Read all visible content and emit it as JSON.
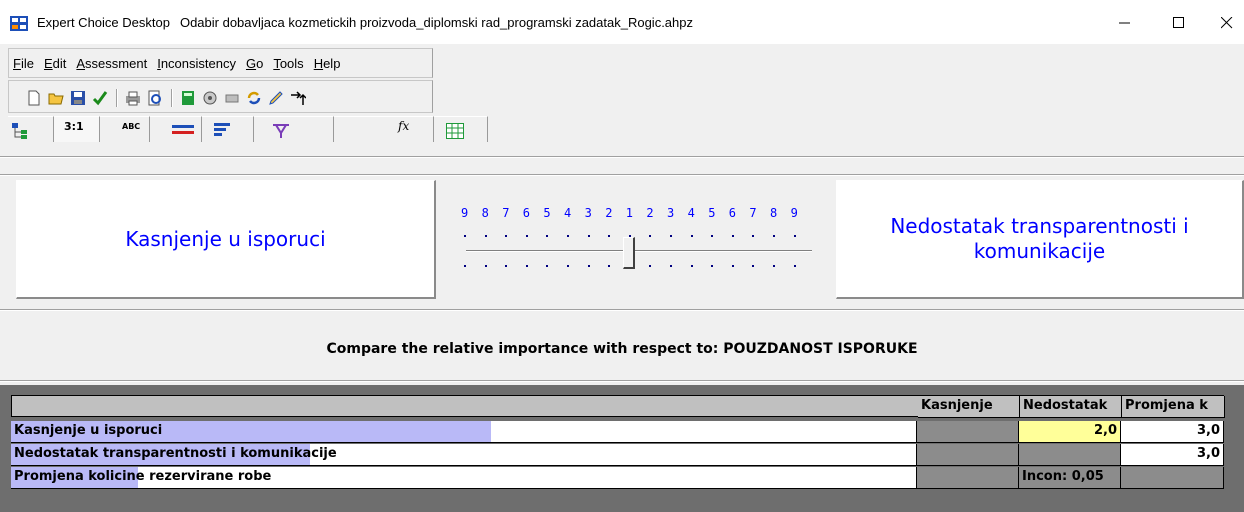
{
  "window": {
    "app_name": "Expert Choice Desktop",
    "document": "Odabir dobavljaca kozmetickih proizvoda_diplomski rad_programski zadatak_Rogic.ahpz"
  },
  "menu": [
    "File",
    "Edit",
    "Assessment",
    "Inconsistency",
    "Go",
    "Tools",
    "Help"
  ],
  "toolbar_icons": [
    "new-icon",
    "open-icon",
    "save-icon",
    "check-icon",
    "print-icon",
    "print-preview-icon",
    "calculator-icon",
    "settings-icon",
    "eraser-icon",
    "refresh-icon",
    "pen-icon",
    "move-up-icon"
  ],
  "tabs": {
    "tree_icon": "tree-icon",
    "numerical_label": "3:1",
    "verbal_label": "ABC",
    "graphical_icon": "bar-graph-icon",
    "questionnaire_icon": "list-icon",
    "hierarchy_icon": "hierarchy-icon",
    "formula_label": "fx",
    "grid_icon": "grid-icon"
  },
  "comparison": {
    "left_item": "Kasnjenje u isporuci",
    "right_item_line1": "Nedostatak transparentnosti i",
    "right_item_line2": "komunikacije",
    "scale_numbers": [
      "9",
      "8",
      "7",
      "6",
      "5",
      "4",
      "3",
      "2",
      "1",
      "2",
      "3",
      "4",
      "5",
      "6",
      "7",
      "8",
      "9"
    ],
    "slider_value": 1,
    "prompt": "Compare the relative importance with respect to: POUZDANOST ISPORUKE"
  },
  "matrix": {
    "columns": [
      "Kasnjenje",
      "Nedostatak",
      "Promjena k"
    ],
    "rows": [
      {
        "label": "Kasnjenje u isporuci",
        "bar_fraction": 0.53,
        "cells": [
          "",
          "2,0",
          "3,0"
        ]
      },
      {
        "label": "Nedostatak transparentnosti i komunikacije",
        "bar_fraction": 0.33,
        "cells": [
          "",
          "",
          "3,0"
        ]
      },
      {
        "label": "Promjena kolicine rezervirane robe",
        "bar_fraction": 0.14,
        "cells": [
          "",
          "Incon: 0,05",
          ""
        ]
      }
    ]
  },
  "colors": {
    "accent_text": "#0000ff",
    "priority_bar": "#b9b9f7",
    "selected_cell": "#ffff99",
    "grid_background": "#6e6e6e"
  }
}
